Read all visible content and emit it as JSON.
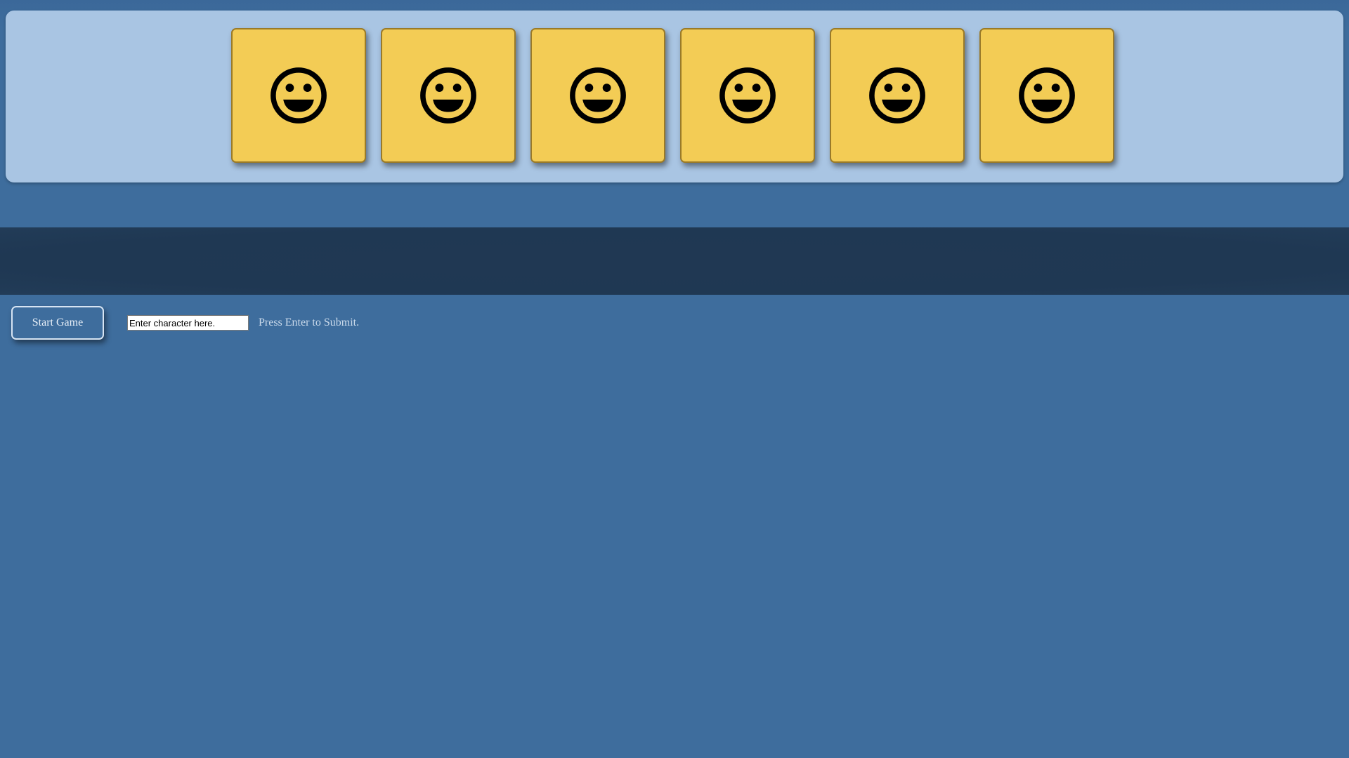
{
  "tiles": [
    {
      "icon": "smiley-face-icon"
    },
    {
      "icon": "smiley-face-icon"
    },
    {
      "icon": "smiley-face-icon"
    },
    {
      "icon": "smiley-face-icon"
    },
    {
      "icon": "smiley-face-icon"
    },
    {
      "icon": "smiley-face-icon"
    }
  ],
  "word_display": "",
  "controls": {
    "start_label": "Start Game",
    "input_placeholder": "Enter character here.",
    "input_value": "",
    "hint": "Press Enter to Submit."
  },
  "colors": {
    "background": "#3e6d9d",
    "panel": "#a9c5e3",
    "tile": "#f3cc55",
    "band": "#1f3853",
    "face": "#000000"
  }
}
